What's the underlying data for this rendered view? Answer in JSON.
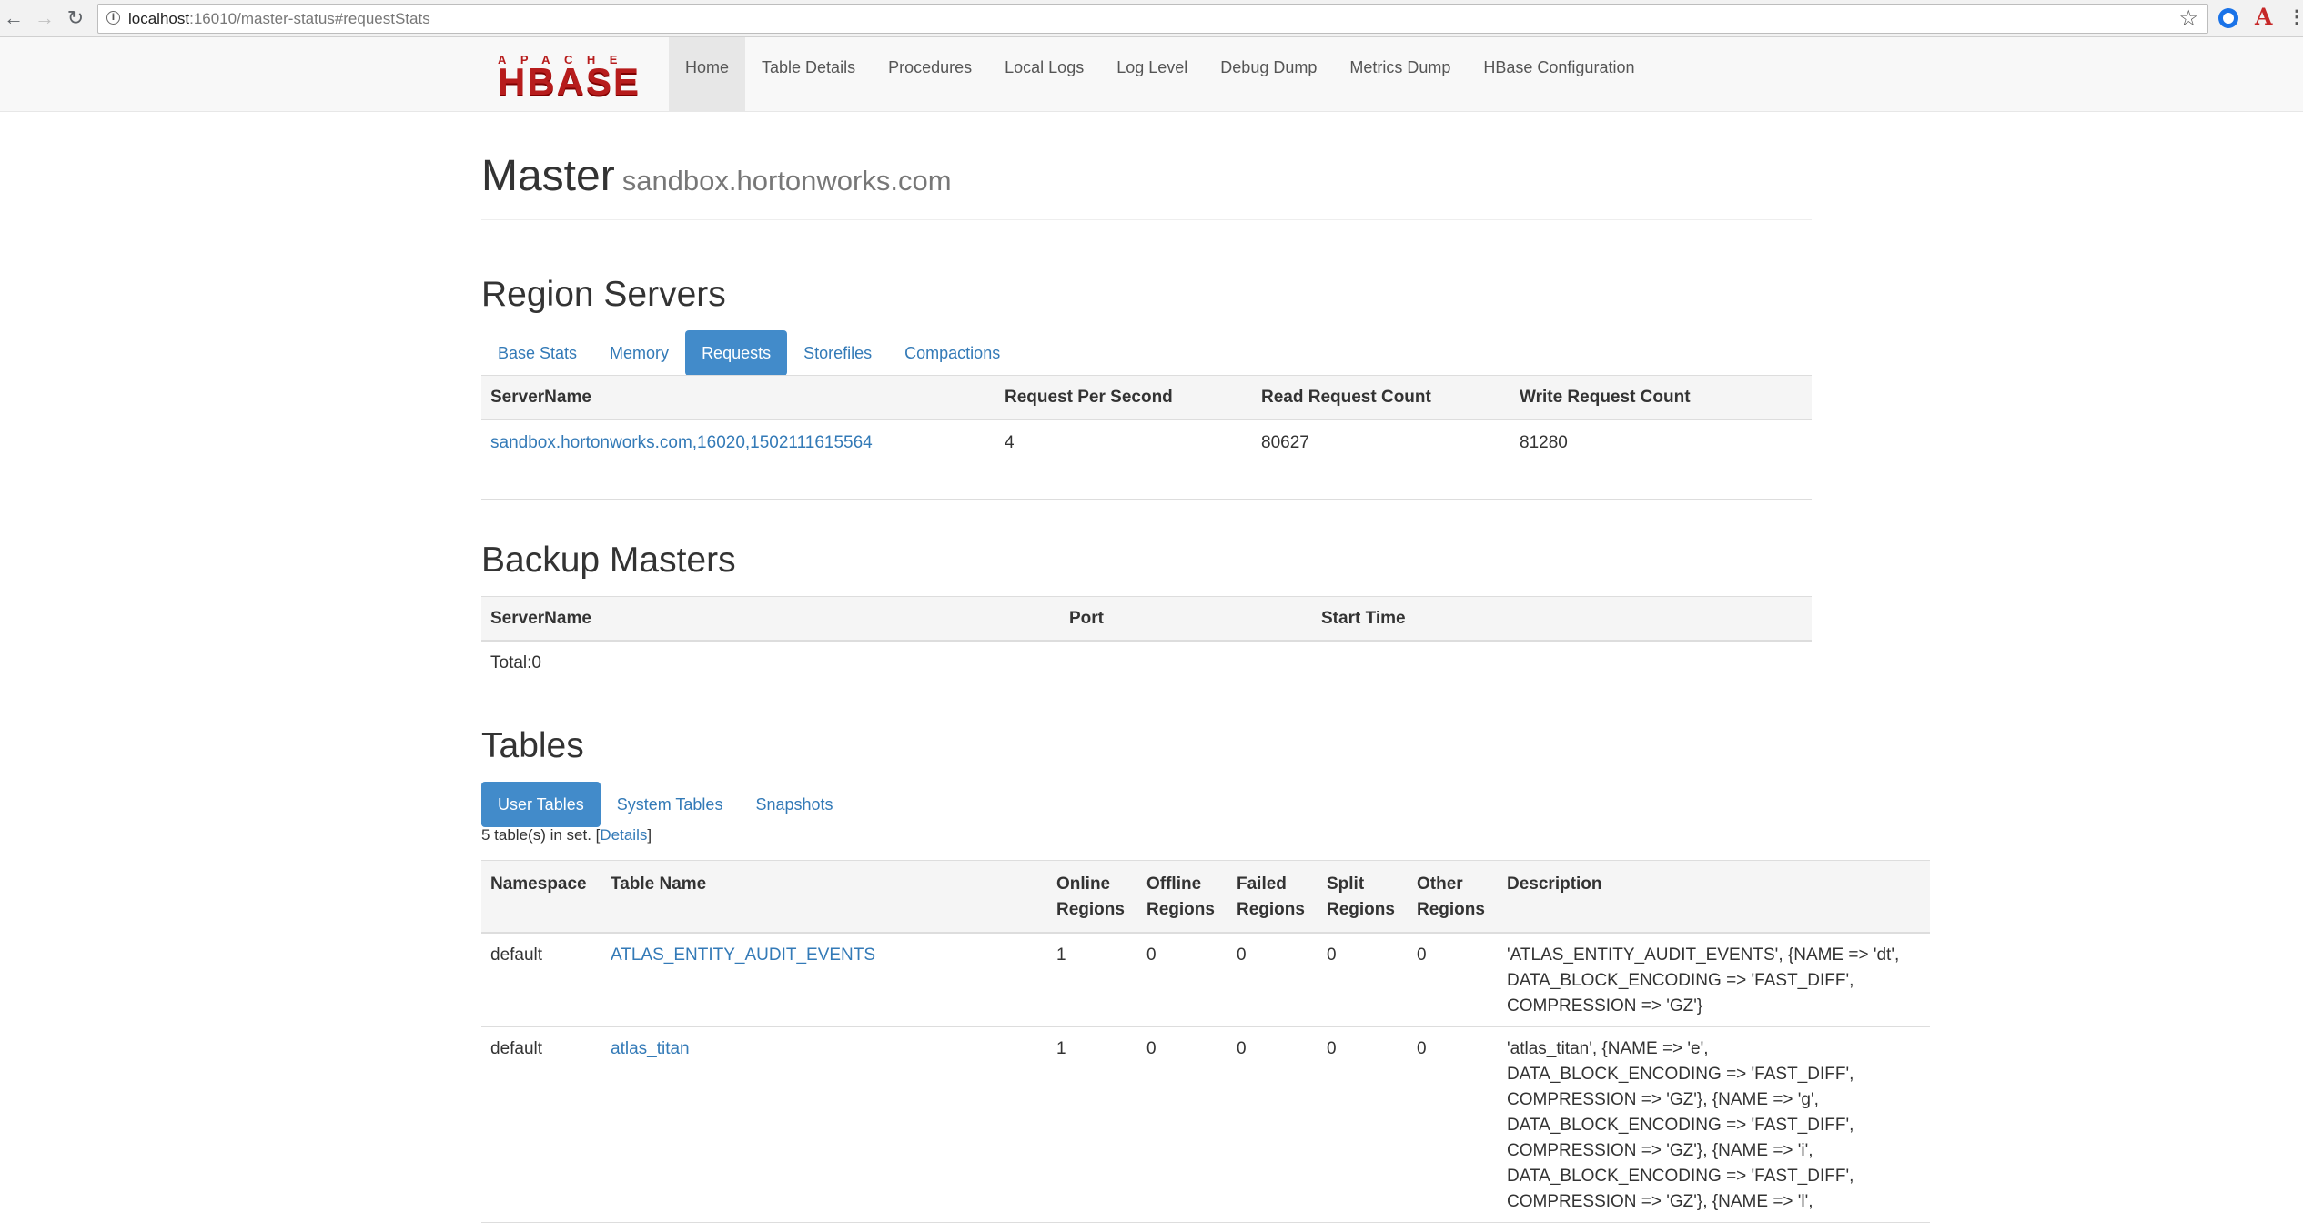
{
  "browser": {
    "url_host": "localhost",
    "url_rest": ":16010/master-status#requestStats"
  },
  "navbar": {
    "logo_top": "APACHE",
    "logo_main": "HBASE",
    "links": [
      {
        "label": "Home"
      },
      {
        "label": "Table Details"
      },
      {
        "label": "Procedures"
      },
      {
        "label": "Local Logs"
      },
      {
        "label": "Log Level"
      },
      {
        "label": "Debug Dump"
      },
      {
        "label": "Metrics Dump"
      },
      {
        "label": "HBase Configuration"
      }
    ]
  },
  "header": {
    "title": "Master",
    "host": "sandbox.hortonworks.com"
  },
  "region_servers": {
    "heading": "Region Servers",
    "tabs": [
      {
        "label": "Base Stats"
      },
      {
        "label": "Memory"
      },
      {
        "label": "Requests"
      },
      {
        "label": "Storefiles"
      },
      {
        "label": "Compactions"
      }
    ],
    "columns": [
      "ServerName",
      "Request Per Second",
      "Read Request Count",
      "Write Request Count"
    ],
    "rows": [
      {
        "server": "sandbox.hortonworks.com,16020,1502111615564",
        "rps": "4",
        "reads": "80627",
        "writes": "81280"
      }
    ]
  },
  "backup_masters": {
    "heading": "Backup Masters",
    "columns": [
      "ServerName",
      "Port",
      "Start Time"
    ],
    "total": "Total:0"
  },
  "tables": {
    "heading": "Tables",
    "tabs": [
      {
        "label": "User Tables"
      },
      {
        "label": "System Tables"
      },
      {
        "label": "Snapshots"
      }
    ],
    "count_prefix": "5 table(s) in set. [",
    "details_link": "Details",
    "count_suffix": "]",
    "columns": {
      "namespace": "Namespace",
      "table_name": "Table Name",
      "online_1": "Online",
      "online_2": "Regions",
      "offline_1": "Offline",
      "offline_2": "Regions",
      "failed_1": "Failed",
      "failed_2": "Regions",
      "split_1": "Split",
      "split_2": "Regions",
      "other_1": "Other",
      "other_2": "Regions",
      "description": "Description"
    },
    "rows": [
      {
        "namespace": "default",
        "name": "ATLAS_ENTITY_AUDIT_EVENTS",
        "online": "1",
        "offline": "0",
        "failed": "0",
        "split": "0",
        "other": "0",
        "desc_lines": [
          "'ATLAS_ENTITY_AUDIT_EVENTS', {NAME => 'dt',",
          "DATA_BLOCK_ENCODING => 'FAST_DIFF',",
          "COMPRESSION => 'GZ'}"
        ]
      },
      {
        "namespace": "default",
        "name": "atlas_titan",
        "online": "1",
        "offline": "0",
        "failed": "0",
        "split": "0",
        "other": "0",
        "desc_lines": [
          "'atlas_titan', {NAME => 'e',",
          "DATA_BLOCK_ENCODING => 'FAST_DIFF',",
          "COMPRESSION => 'GZ'}, {NAME => 'g',",
          "DATA_BLOCK_ENCODING => 'FAST_DIFF',",
          "COMPRESSION => 'GZ'}, {NAME => 'i',",
          "DATA_BLOCK_ENCODING => 'FAST_DIFF',",
          "COMPRESSION => 'GZ'}, {NAME => 'l',"
        ]
      }
    ]
  }
}
